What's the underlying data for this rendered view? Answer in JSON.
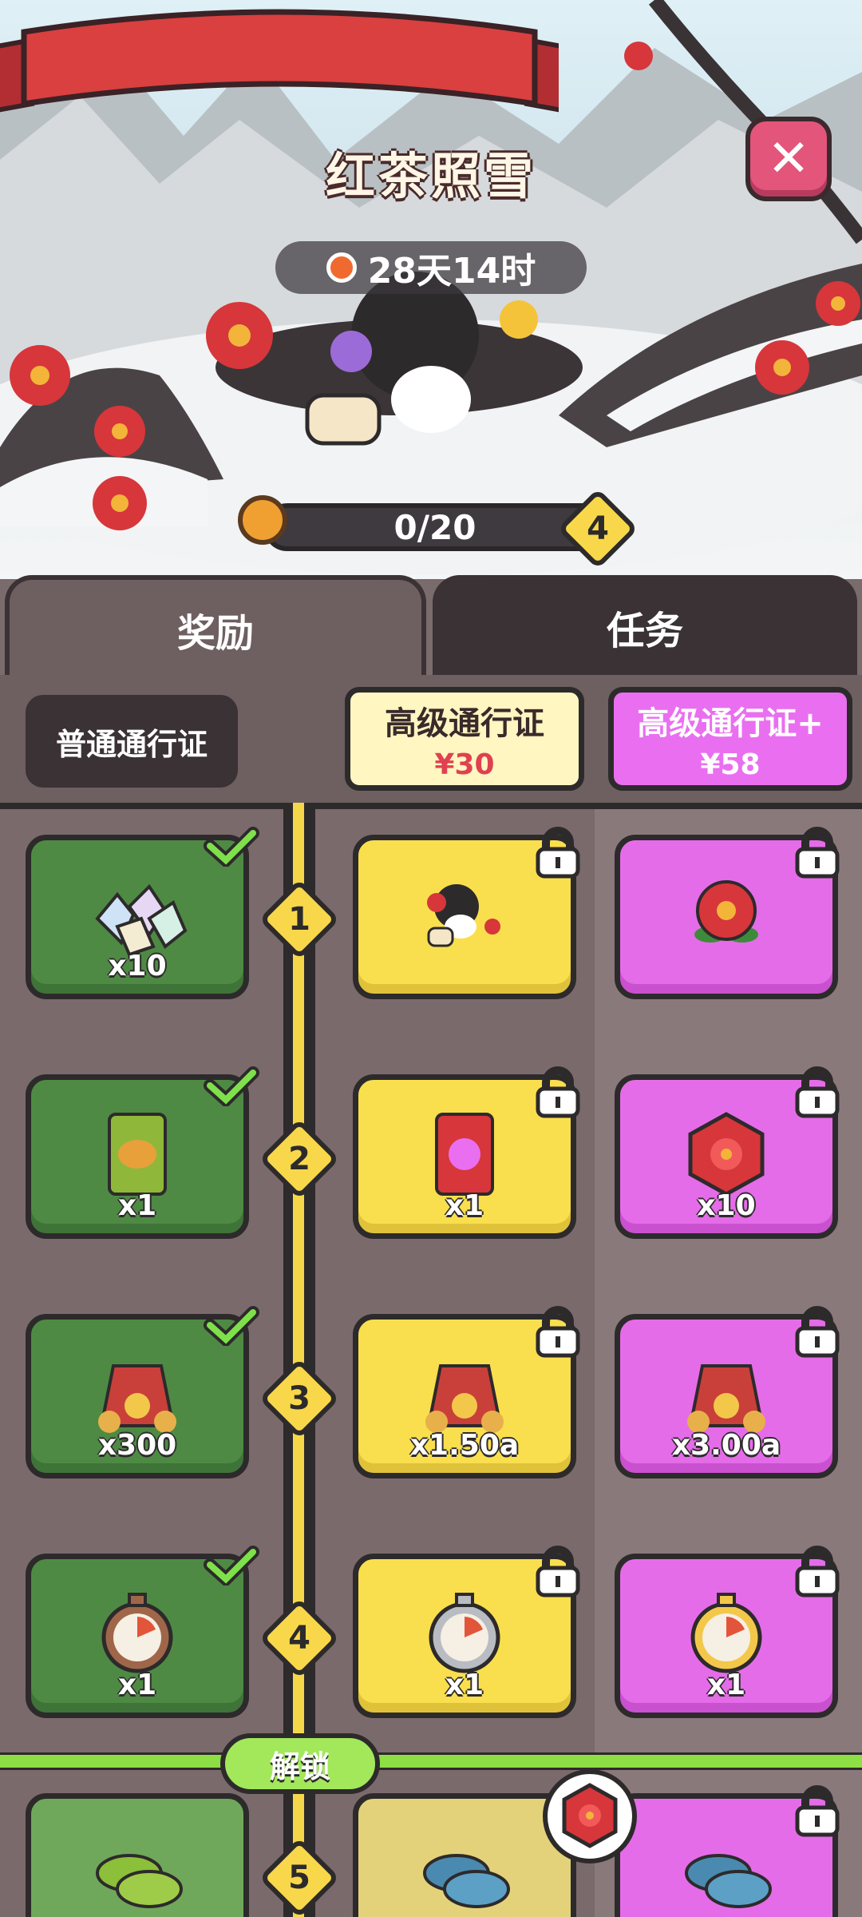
{
  "header": {
    "title": "红茶照雪",
    "close_icon": "close-icon",
    "timer_text": "28天14时",
    "progress_text": "0/20",
    "level_badge": "4"
  },
  "tabs": [
    {
      "label": "奖励",
      "active": true
    },
    {
      "label": "任务",
      "active": false
    }
  ],
  "passes": {
    "free": {
      "label": "普通通行证"
    },
    "premium": {
      "label": "高级通行证",
      "price": "¥30"
    },
    "premium_plus": {
      "label": "高级通行证+",
      "price": "¥58"
    }
  },
  "reward_tiers": [
    {
      "level": "1",
      "free": {
        "amount": "x10",
        "icon": "crystal-shards-icon",
        "claimed": true
      },
      "premium": {
        "amount": "",
        "icon": "character-skin-icon",
        "locked": true
      },
      "premium_plus": {
        "amount": "",
        "icon": "red-flower-icon",
        "locked": true
      }
    },
    {
      "level": "2",
      "free": {
        "amount": "x1",
        "icon": "seed-pack-green-icon",
        "claimed": true
      },
      "premium": {
        "amount": "x1",
        "icon": "seed-pack-red-icon",
        "locked": true
      },
      "premium_plus": {
        "amount": "x10",
        "icon": "flower-hexagon-token-icon",
        "locked": true
      }
    },
    {
      "level": "3",
      "free": {
        "amount": "x300",
        "icon": "gold-sack-icon",
        "claimed": true
      },
      "premium": {
        "amount": "x1.50a",
        "icon": "gold-sack-icon",
        "locked": true
      },
      "premium_plus": {
        "amount": "x3.00a",
        "icon": "gold-sack-icon",
        "locked": true
      }
    },
    {
      "level": "4",
      "free": {
        "amount": "x1",
        "icon": "stopwatch-bronze-icon",
        "claimed": true
      },
      "premium": {
        "amount": "x1",
        "icon": "stopwatch-silver-icon",
        "locked": true
      },
      "premium_plus": {
        "amount": "x1",
        "icon": "stopwatch-gold-icon",
        "locked": true
      }
    },
    {
      "level": "5",
      "free": {
        "amount": "",
        "icon": "green-coin-stack-icon",
        "claimed": false
      },
      "premium": {
        "amount": "",
        "icon": "blue-coin-stack-icon",
        "locked": false
      },
      "premium_plus": {
        "amount": "",
        "icon": "blue-coin-stack-icon",
        "locked": true
      }
    }
  ],
  "unlock_label": "解锁",
  "colors": {
    "free": "#4e8a44",
    "premium": "#f9df4e",
    "premium_plus": "#e56ce8",
    "ribbon": "#d9403f"
  }
}
